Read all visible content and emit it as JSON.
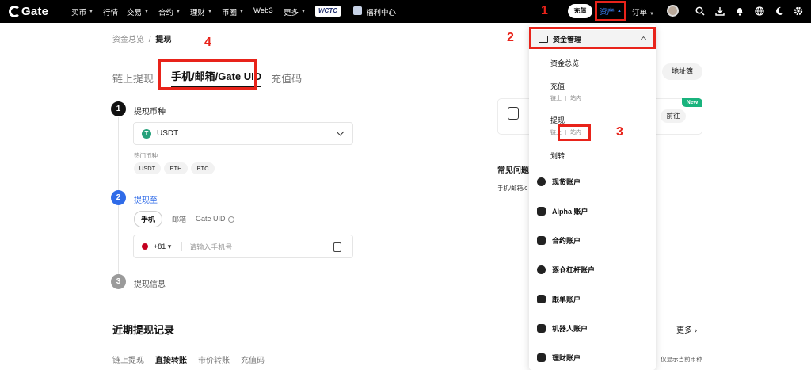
{
  "nav": {
    "logo": "Gate",
    "items": [
      {
        "label": "买币",
        "caret": true
      },
      {
        "label": "行情",
        "caret": false
      },
      {
        "label": "交易",
        "caret": true
      },
      {
        "label": "合约",
        "caret": true
      },
      {
        "label": "理财",
        "caret": true
      },
      {
        "label": "币圈",
        "caret": true
      },
      {
        "label": "Web3",
        "caret": false
      },
      {
        "label": "更多",
        "caret": true
      }
    ],
    "wctc": "WCTC",
    "welfare": "福利中心",
    "recharge": "充值",
    "assets": "资产",
    "orders": "订单"
  },
  "annotations": [
    "1",
    "2",
    "3",
    "4"
  ],
  "breadcrumb": {
    "parent": "资金总览",
    "sep": "/",
    "current": "提现"
  },
  "tabs": [
    "链上提现",
    "手机/邮箱/Gate UID",
    "充值码"
  ],
  "steps": [
    {
      "num": "1",
      "label": "提现币种"
    },
    {
      "num": "2",
      "label": "提现至"
    },
    {
      "num": "3",
      "label": "提现信息"
    }
  ],
  "coin": {
    "symbol_glyph": "T",
    "selected": "USDT"
  },
  "hot_coins": {
    "title": "热门币种",
    "items": [
      "USDT",
      "ETH",
      "BTC"
    ]
  },
  "target_tabs": [
    "手机",
    "邮箱",
    "Gate UID"
  ],
  "phone": {
    "code": "+81 ▾",
    "placeholder": "请输入手机号"
  },
  "records": {
    "title": "近期提现记录",
    "more": "更多 ›",
    "tabs": [
      "链上提现",
      "直接转账",
      "带价转账",
      "充值码"
    ],
    "only_current": "仅显示当前币种"
  },
  "right_panel": {
    "address_book": "地址簿",
    "new_badge": "New",
    "goto": "前往",
    "faq": "常见问题",
    "faq_item": "手机/邮箱/G"
  },
  "dropdown": {
    "header": "资金管理",
    "subs": [
      {
        "label": "资金总览"
      },
      {
        "label": "充值",
        "sub": [
          "链上",
          "站内"
        ]
      },
      {
        "label": "提现",
        "sub": [
          "链上",
          "站内"
        ]
      },
      {
        "label": "划转"
      }
    ],
    "accounts": [
      "现货账户",
      "Alpha 账户",
      "合约账户",
      "逐仓杠杆账户",
      "跟单账户",
      "机器人账户",
      "理财账户"
    ]
  },
  "colors": {
    "accent": "#3b82f6",
    "annotation": "#e8231a",
    "usdt": "#26a17b",
    "new": "#19b37d"
  }
}
